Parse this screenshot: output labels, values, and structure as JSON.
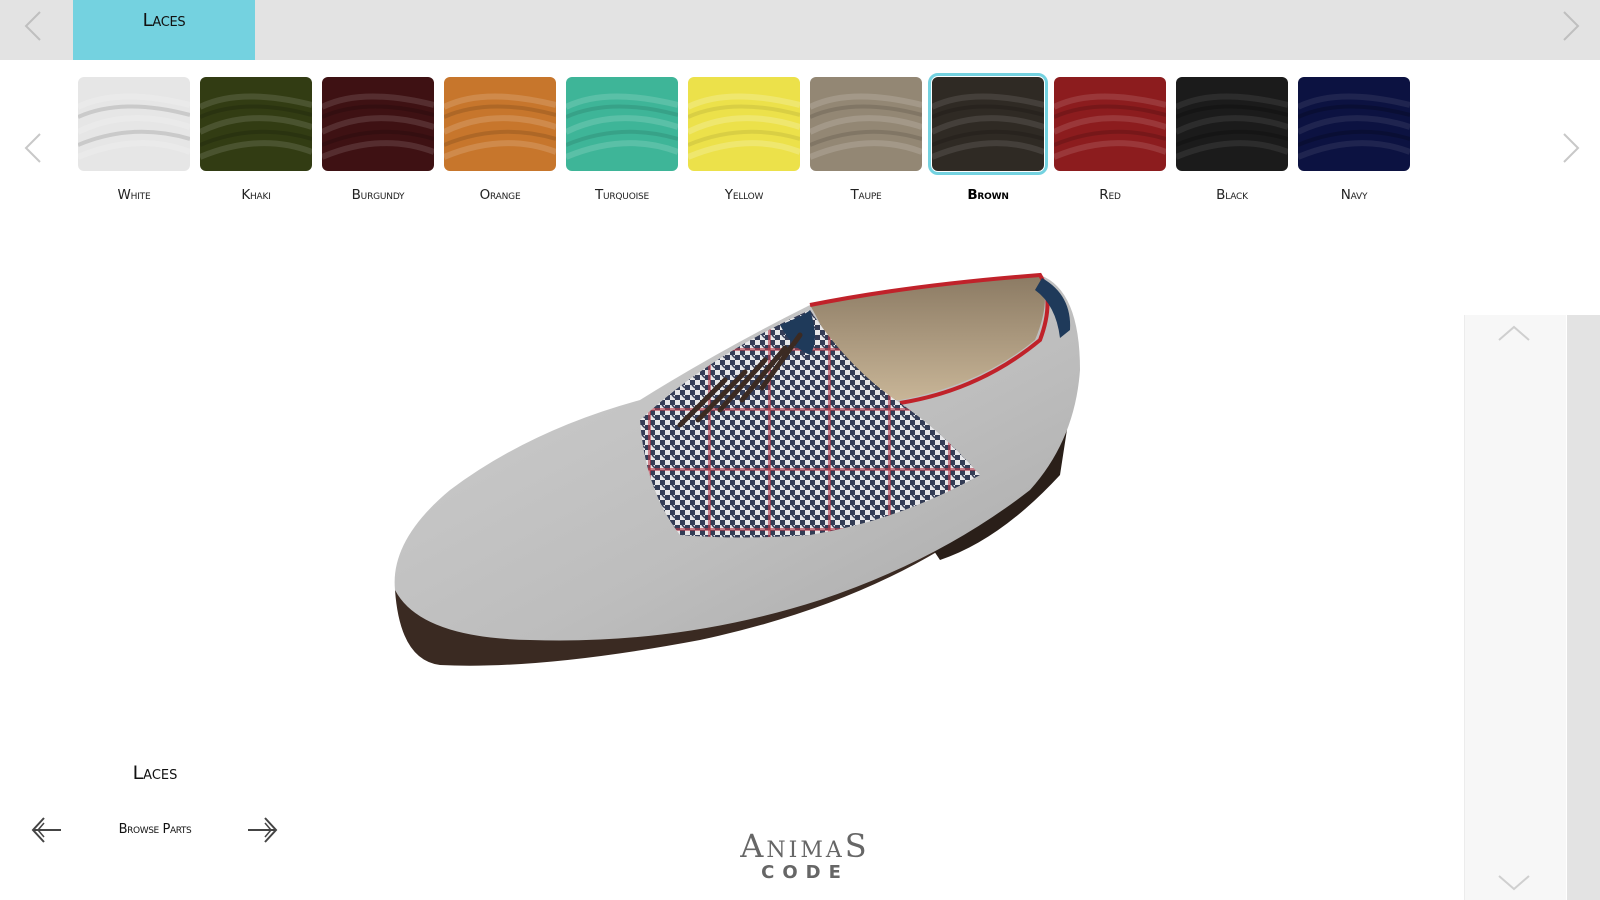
{
  "topbar": {
    "active_tab": "Laces",
    "prev_icon": "chevron-left-icon",
    "next_icon": "chevron-right-icon"
  },
  "swatches": {
    "selected": "Brown",
    "items": [
      {
        "label": "White",
        "color": "#e6e6e6"
      },
      {
        "label": "Khaki",
        "color": "#323c13"
      },
      {
        "label": "Burgundy",
        "color": "#3e1113"
      },
      {
        "label": "Orange",
        "color": "#c7762c"
      },
      {
        "label": "Turquoise",
        "color": "#3eb598"
      },
      {
        "label": "Yellow",
        "color": "#ece14a"
      },
      {
        "label": "Taupe",
        "color": "#938774"
      },
      {
        "label": "Brown",
        "color": "#2f2a24"
      },
      {
        "label": "Red",
        "color": "#8c1c1e"
      },
      {
        "label": "Black",
        "color": "#1b1b1b"
      },
      {
        "label": "Navy",
        "color": "#0c1241"
      }
    ]
  },
  "viewer": {
    "upper_color": "#bdbdbd",
    "quarter_color": "#6a6f80",
    "welt_color": "#3a2a22",
    "collar_color": "#c0222a",
    "heel_tab_color": "#1f3a5a",
    "lace_color": "#3b2a22"
  },
  "browse": {
    "part_title": "Laces",
    "label": "Browse Parts",
    "prev_icon": "arrow-left-icon",
    "next_icon": "arrow-right-icon"
  },
  "logo": {
    "line1": "AnimaS",
    "line2": "CODE"
  },
  "side_panel": {
    "up_icon": "chevron-up-icon",
    "down_icon": "chevron-down-icon"
  },
  "colors": {
    "accent": "#74d2e0",
    "bar_bg": "#e3e3e3"
  }
}
